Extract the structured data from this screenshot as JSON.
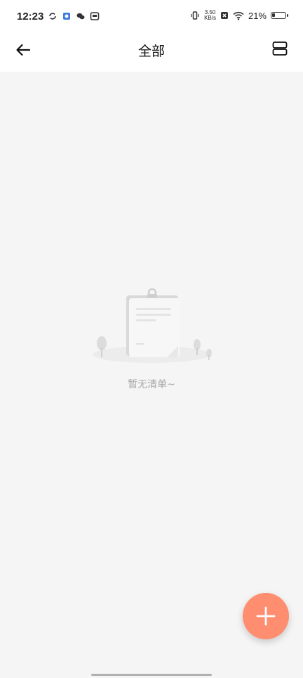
{
  "status_bar": {
    "time": "12:23",
    "net_speed_value": "3.50",
    "net_speed_unit": "KB/s",
    "battery_percent": "21%",
    "battery_level": 0.21
  },
  "nav": {
    "title": "全部"
  },
  "empty_state": {
    "message": "暂无清单~"
  },
  "colors": {
    "fab": "#ff8d70",
    "background": "#f5f5f5",
    "header": "#ffffff",
    "empty_text": "#a8a8a8"
  }
}
